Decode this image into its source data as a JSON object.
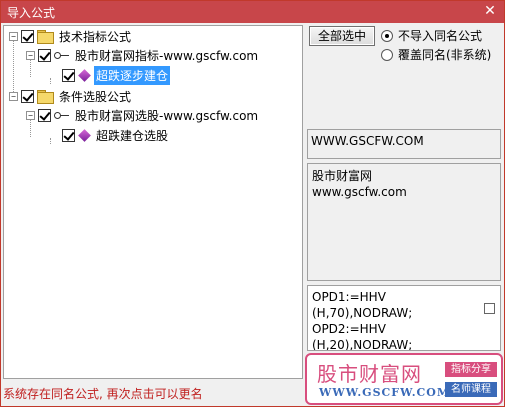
{
  "window": {
    "title": "导入公式",
    "close_glyph": "✕"
  },
  "tree": {
    "groups": [
      {
        "label": "技术指标公式",
        "expander": "−",
        "checked": true,
        "child": {
          "label": "股市财富网指标-www.gscfw.com",
          "expander": "−",
          "checked": true,
          "leaf": {
            "label": "超跌逐步建仓",
            "checked": true,
            "selected": true
          }
        }
      },
      {
        "label": "条件选股公式",
        "expander": "−",
        "checked": true,
        "child": {
          "label": "股市财富网选股-www.gscfw.com",
          "expander": "−",
          "checked": true,
          "leaf": {
            "label": "超跌建仓选股",
            "checked": true,
            "selected": false
          }
        }
      }
    ]
  },
  "controls": {
    "select_all_label": "全部选中",
    "radio_no_import": "不导入同名公式",
    "radio_overwrite": "覆盖同名(非系统)",
    "selected_radio": "no_import"
  },
  "info": {
    "site": "WWW.GSCFW.COM",
    "desc_line1": "股市财富网",
    "desc_line2": "www.gscfw.com"
  },
  "code": {
    "lines": [
      "OPD1:=HHV",
      "(H,70),NODRAW;",
      "OPD2:=HHV",
      "(H,20),NODRAW;"
    ]
  },
  "watermark": {
    "title": "股市财富网",
    "url": "WWW.GSCFW.COM",
    "tag1": "指标分享",
    "tag2": "名师课程"
  },
  "status": "系统存在同名公式, 再次点击可以更名",
  "colors": {
    "title_bar": "#c8464a",
    "selection": "#3399ff",
    "status_text": "#c0201f",
    "brand_pink": "#d84e7e",
    "brand_blue": "#3a6ab8"
  }
}
